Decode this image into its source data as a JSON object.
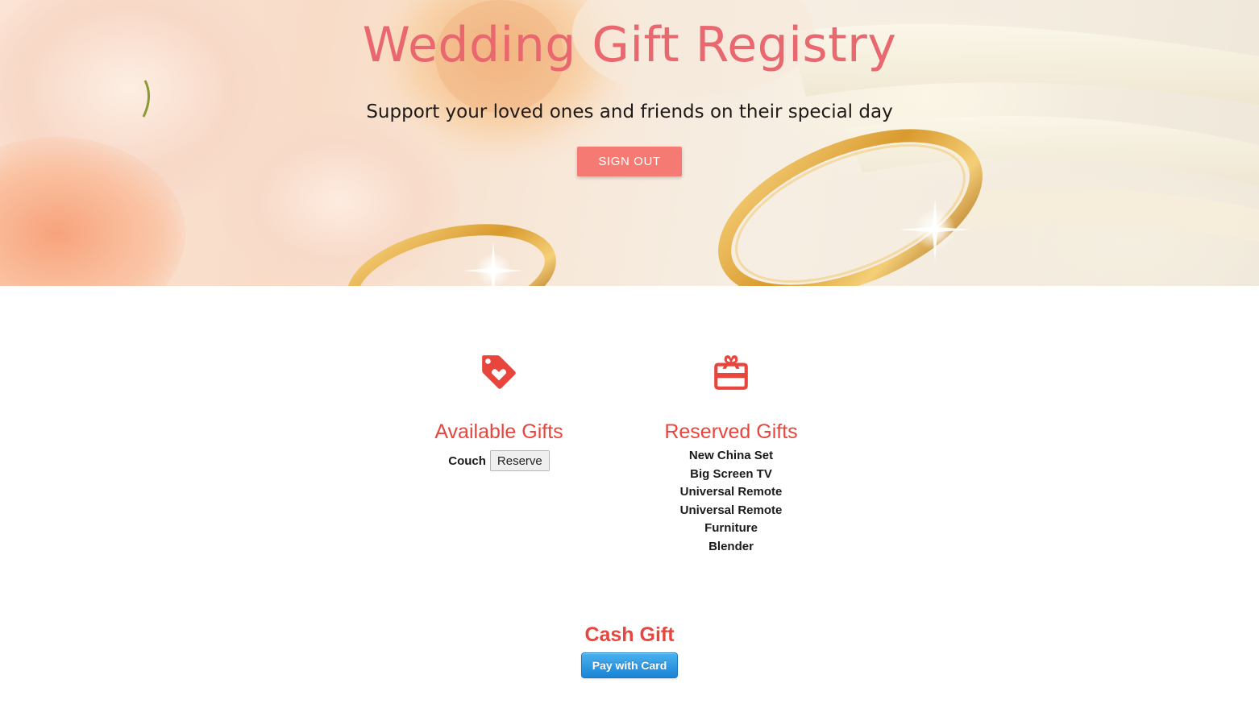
{
  "hero": {
    "title": "Wedding Gift Registry",
    "subtitle": "Support your loved ones and friends on their special day",
    "sign_out_label": "SIGN OUT"
  },
  "available": {
    "icon": "heart-tag-icon",
    "heading": "Available Gifts",
    "items": [
      {
        "name": "Couch",
        "action_label": "Reserve"
      }
    ]
  },
  "reserved": {
    "icon": "gift-card-icon",
    "heading": "Reserved Gifts",
    "items": [
      "New China Set",
      "Big Screen TV",
      "Universal Remote",
      "Universal Remote",
      "Furniture",
      "Blender"
    ]
  },
  "cash": {
    "heading": "Cash Gift",
    "pay_label": "Pay with Card"
  },
  "colors": {
    "accent": "#e8453c",
    "title": "#e9676f",
    "sign_out_button": "#f47a73",
    "pay_button": "#1a84d6"
  }
}
